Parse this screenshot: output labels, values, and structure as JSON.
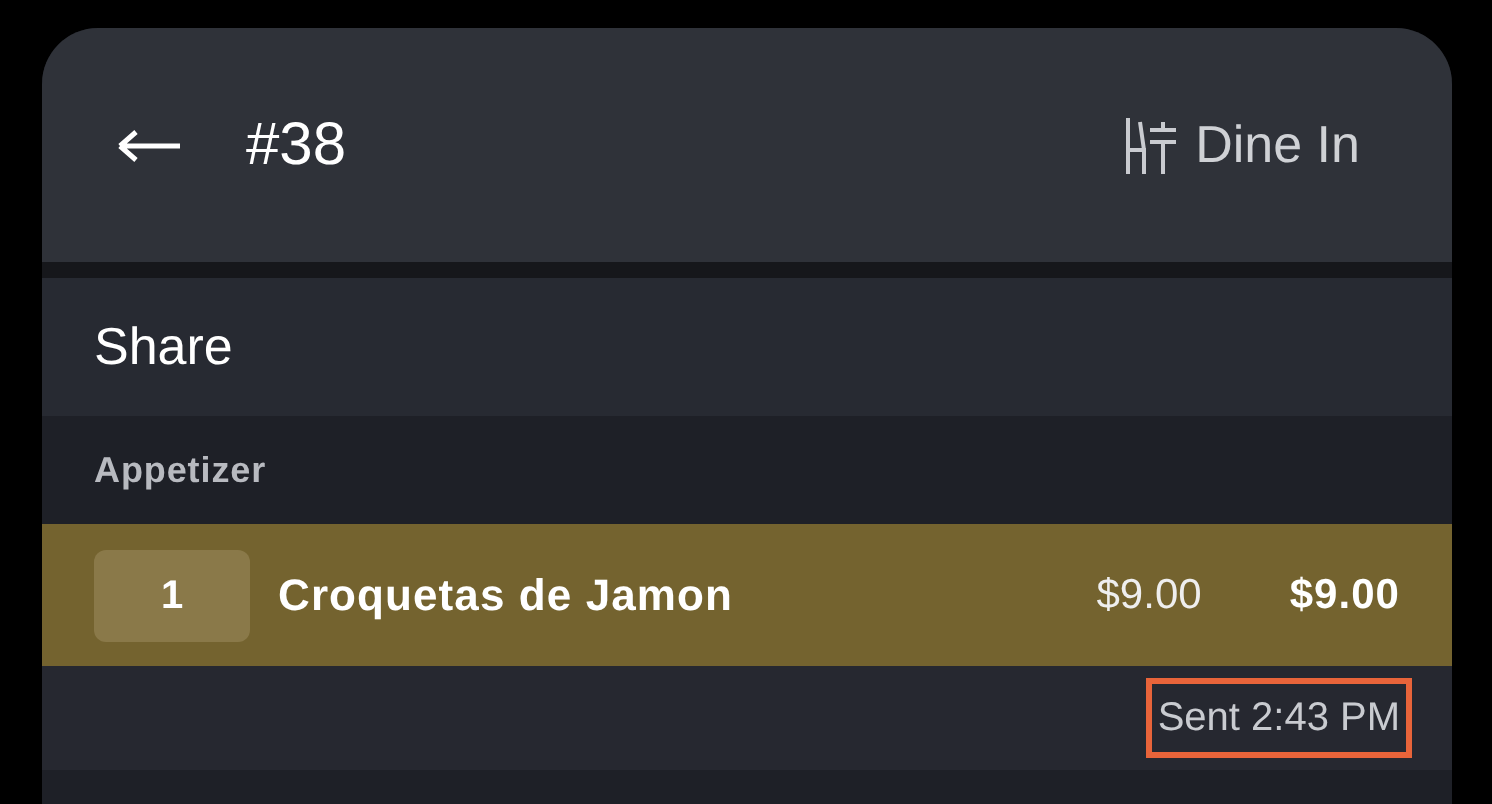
{
  "header": {
    "order_number": "#38",
    "order_type": "Dine In"
  },
  "section": {
    "title": "Share"
  },
  "category": "Appetizer",
  "items": [
    {
      "quantity": "1",
      "name": "Croquetas de Jamon",
      "unit_price": "$9.00",
      "total": "$9.00",
      "selected": true,
      "sent": "Sent 2:43 PM",
      "highlighted": true
    }
  ]
}
